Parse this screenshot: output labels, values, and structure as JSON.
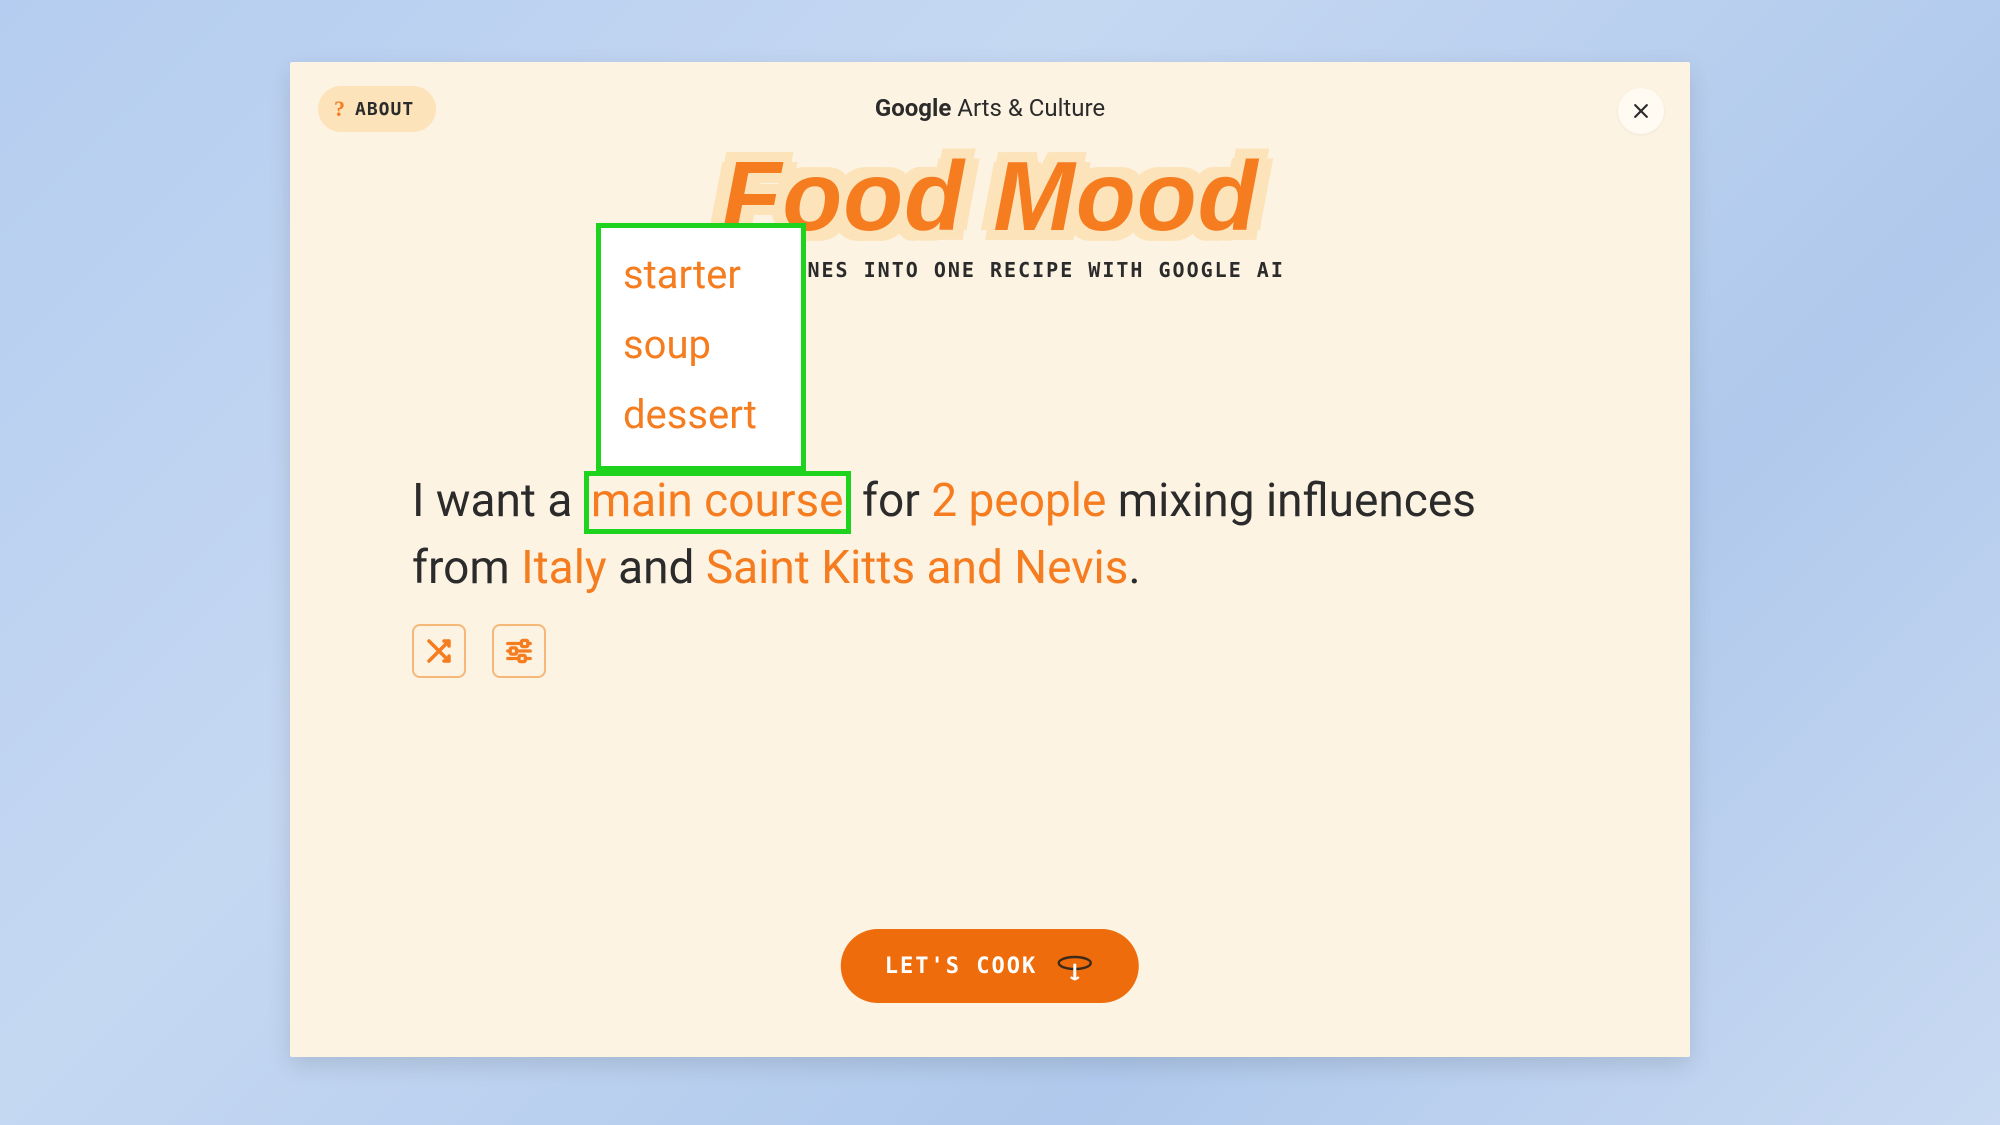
{
  "header": {
    "about_label": "ABOUT",
    "brand_google": "Google",
    "brand_rest": " Arts & Culture"
  },
  "title": "Food Mood",
  "subtitle": "WO CUISINES INTO ONE RECIPE WITH GOOGLE AI",
  "dish_dropdown": {
    "options": [
      "starter",
      "soup",
      "dessert"
    ],
    "selected": "main course"
  },
  "sentence": {
    "prefix": "I want a ",
    "dish": "main course",
    "for_label": " for ",
    "people": "2 people",
    "mixing_label": " mixing influences from ",
    "cuisine_a": "Italy",
    "and_label": " and ",
    "cuisine_b": "Saint Kitts and Nevis",
    "suffix": "."
  },
  "actions": {
    "cook_label": "LET'S COOK"
  },
  "colors": {
    "accent": "#f57c1f",
    "highlight_border": "#1dd31d",
    "panel_bg": "#fdf3e3",
    "cta_bg": "#ee6c0b"
  }
}
